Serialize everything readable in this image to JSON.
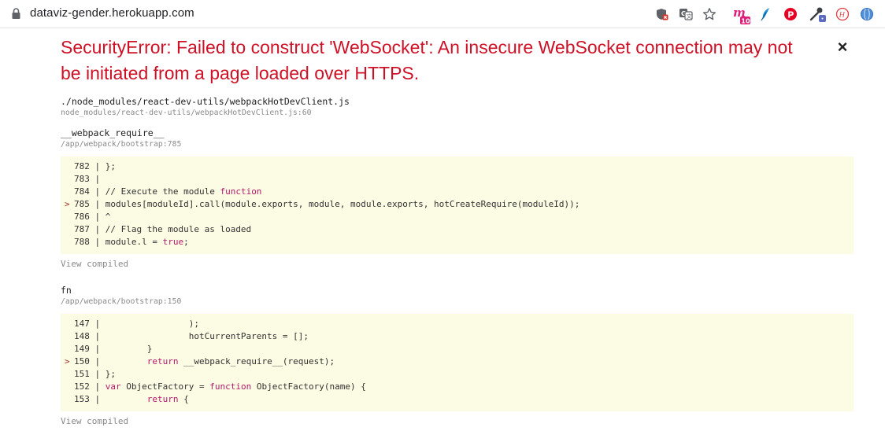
{
  "browser": {
    "url": "dataviz-gender.herokuapp.com",
    "badge_count": "10"
  },
  "error": {
    "title": "SecurityError: Failed to construct 'WebSocket': An insecure WebSocket connection may not be initiated from a page loaded over HTTPS.",
    "close_label": "×"
  },
  "frames": [
    {
      "name": "./node_modules/react-dev-utils/webpackHotDevClient.js",
      "location": "node_modules/react-dev-utils/webpackHotDevClient.js:60"
    },
    {
      "name": "__webpack_require__",
      "location": "/app/webpack/bootstrap:785",
      "view_compiled": "View compiled",
      "code": [
        {
          "marker": "",
          "num": "782",
          "code": "};"
        },
        {
          "marker": "",
          "num": "783",
          "code": ""
        },
        {
          "marker": "",
          "num": "784",
          "code": "// Execute the module function"
        },
        {
          "marker": ">",
          "num": "785",
          "code": "modules[moduleId].call(module.exports, module, module.exports, hotCreateRequire(moduleId));"
        },
        {
          "marker": "",
          "num": "786",
          "code": "^"
        },
        {
          "marker": "",
          "num": "787",
          "code": "// Flag the module as loaded"
        },
        {
          "marker": "",
          "num": "788",
          "code": "module.l = true;"
        }
      ]
    },
    {
      "name": "fn",
      "location": "/app/webpack/bootstrap:150",
      "view_compiled": "View compiled",
      "code": [
        {
          "marker": "",
          "num": "147",
          "code": "                );"
        },
        {
          "marker": "",
          "num": "148",
          "code": "                hotCurrentParents = [];"
        },
        {
          "marker": "",
          "num": "149",
          "code": "        }"
        },
        {
          "marker": ">",
          "num": "150",
          "code": "        return __webpack_require__(request);"
        },
        {
          "marker": "",
          "num": "151",
          "code": "};"
        },
        {
          "marker": "",
          "num": "152",
          "code": "var ObjectFactory = function ObjectFactory(name) {"
        },
        {
          "marker": "",
          "num": "153",
          "code": "        return {"
        }
      ]
    }
  ]
}
